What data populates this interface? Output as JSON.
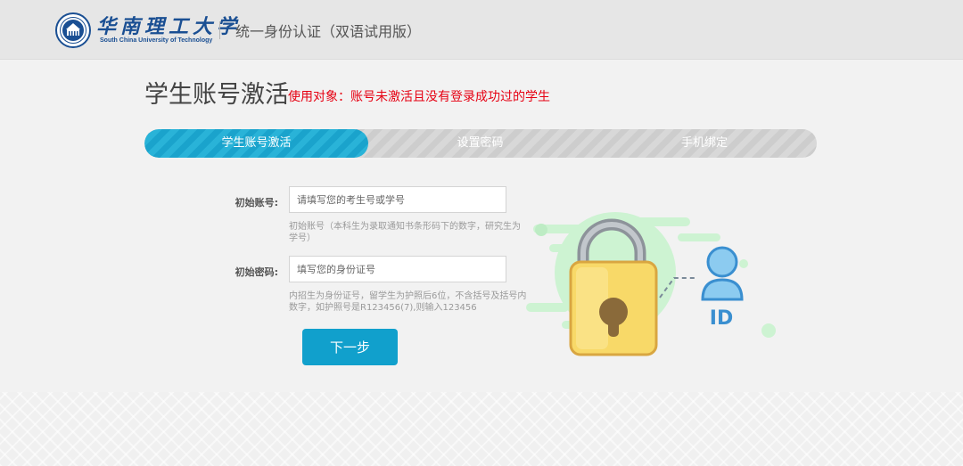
{
  "header": {
    "university_name_cn": "华南理工大学",
    "university_name_en": "South China University of Technology",
    "portal_title": "统一身份认证（双语试用版）"
  },
  "main": {
    "title": "学生账号激活",
    "audience_note": "使用对象：账号未激活且没有登录成功过的学生"
  },
  "steps": [
    {
      "label": "学生账号激活",
      "active": true
    },
    {
      "label": "设置密码",
      "active": false
    },
    {
      "label": "手机绑定",
      "active": false
    }
  ],
  "form": {
    "account": {
      "label": "初始账号:",
      "placeholder": "请填写您的考生号或学号",
      "value": "",
      "hint": "初始账号（本科生为录取通知书条形码下的数字，研究生为学号）"
    },
    "password": {
      "label": "初始密码:",
      "placeholder": "填写您的身份证号",
      "value": "",
      "hint": "内招生为身份证号，留学生为护照后6位，不含括号及括号内数字，如护照号是R123456(7),则输入123456"
    },
    "next_label": "下一步"
  },
  "illustration": {
    "id_text": "ID"
  },
  "colors": {
    "accent": "#11a0cc",
    "note_red": "#e60012",
    "brand_blue": "#1a4f93",
    "lock_yellow": "#f8d968",
    "mint": "#c9f2cf"
  },
  "icons": [
    "university-seal-icon",
    "padlock-icon",
    "user-id-icon"
  ]
}
